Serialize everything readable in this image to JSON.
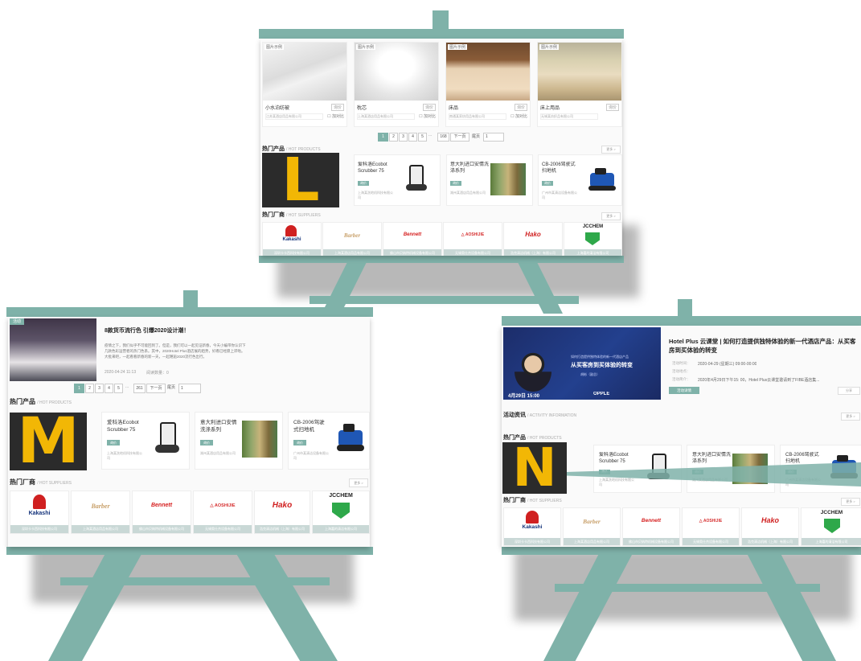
{
  "colors": {
    "teal": "#7fb2a9",
    "letter_fg": "#f2b705",
    "letter_bg": "#2b2b2b",
    "accent_blue": "#1a63c4",
    "pagination_active": "#7fb2a9"
  },
  "boards": {
    "L": {
      "letter": "L",
      "top_products": [
        {
          "title": "小水泊纺被",
          "tag": "询价",
          "supplier": "江苏某酒店用品有限公司",
          "badge": "图片示例"
        },
        {
          "title": "枕芯",
          "tag": "询价",
          "supplier": "上海某酒店用品有限公司",
          "badge": "图片示例"
        },
        {
          "title": "床品",
          "tag": "询价",
          "supplier": "南通某家纺用品有限公司",
          "badge": "图片示例"
        },
        {
          "title": "床上用品",
          "tag": "询价",
          "supplier": "无锡某纺织品有限公司",
          "badge": "图片示例"
        }
      ],
      "compare_label": "☐ 加对比",
      "pagination": {
        "pages": [
          "1",
          "2",
          "3",
          "4",
          "5",
          "...",
          "168"
        ],
        "next": "下一页",
        "last": "尾页",
        "select": "1"
      },
      "hot_products_title": "热门产品",
      "hot_products_sub": "/ HOT PRODUCTS",
      "more": "更多 >",
      "hot_products": [
        {
          "name": "爱科洛Ecobot Scrubber 75",
          "tag": "询价",
          "supplier": "上海某洗地机科技有限公司"
        },
        {
          "name": "意大利进口安情洗涤系列",
          "tag": "询价",
          "supplier": "湖州某酒店用品有限公司"
        },
        {
          "name": "CB-2006驾驶式扫地机",
          "tag": "询价",
          "supplier": "广州市某清洁设备有限公司"
        }
      ],
      "hot_suppliers_title": "热门厂商",
      "hot_suppliers_sub": "/ HOT SUPPLIERS"
    },
    "M": {
      "letter": "M",
      "article": {
        "badge": "活动",
        "title": "8款货币流行色 引爆2020设计潮！",
        "body": "疫情之下，我们似乎不可能回到了。但是，我们可以一起见证新春，今天小编带你认识下几款色彩运营者的热门色系。其中，2020Hotel Plus酒店展的趋势，好看已经愿上岸啦。大批来吧，一起看看新春的新一天，一起邂逅2020流行色出行。",
        "date": "2020-04-24 11:13",
        "reads": "阅读数量：0"
      },
      "pagination": {
        "pages": [
          "1",
          "2",
          "3",
          "4",
          "5",
          "...",
          "261"
        ],
        "next": "下一页",
        "last": "尾页",
        "select": "1"
      },
      "hot_products_title": "热门产品",
      "hot_products_sub": "/ HOT PRODUCTS",
      "hot_products": [
        {
          "name": "爱科洛Ecobot Scrubber 75",
          "tag": "询价",
          "supplier": "上海某洗地机科技有限公司"
        },
        {
          "name": "意大利进口安情洗涤系列",
          "tag": "询价",
          "supplier": "湖州某酒店用品有限公司"
        },
        {
          "name": "CB-2006驾驶式扫地机",
          "tag": "询价",
          "supplier": "广州市某清洁设备有限公司"
        }
      ],
      "hot_suppliers_title": "热门厂商",
      "hot_suppliers_sub": "/ HOT SUPPLIERS",
      "more": "更多 >"
    },
    "N": {
      "letter": "N",
      "event": {
        "title": "Hotel Plus 云课堂 | 如何打造提供独特体验的新一代酒店产品：从买客房到买体验的转变",
        "time_label": "活动时间：",
        "time": "2020-04-29 (星期三) 09:00-00:00",
        "place_label": "活动地点：",
        "intro_label": "活动简介：",
        "intro": "2020年4月29日下午15: 00，Hotel Plus云课堂邀请到了FIBE酒店集...",
        "btn": "活动详情",
        "share": "分享",
        "banner_heading": "从买客房到买体验的转变",
        "banner_sub": "如何打造提供独特体验的新一代酒店产品",
        "banner_date": "4月29日 15:00",
        "banner_brand": "OPPLE",
        "banner_person": "胡彬（副总）"
      },
      "activity_title": "活动资讯",
      "activity_sub": "/ ACTIVITY INFORMATION",
      "more": "更多 >",
      "hot_products_title": "热门产品",
      "hot_products_sub": "/ HOT PRODUCTS",
      "hot_products": [
        {
          "name": "爱科洛Ecobot Scrubber 75",
          "tag": "询价",
          "supplier": "上海某洗地机科技有限公司"
        },
        {
          "name": "意大利进口安情洗涤系列",
          "tag": "询价",
          "supplier": "湖州某酒店用品有限公司"
        },
        {
          "name": "CB-2006驾驶式扫地机",
          "tag": "询价",
          "supplier": "广州市某清洁设备有限公司"
        }
      ],
      "hot_suppliers_title": "热门厂商",
      "hot_suppliers_sub": "/ HOT SUPPLIERS"
    }
  },
  "suppliers": [
    {
      "logo": "Kakashi",
      "sub": "卡卡西科技",
      "caption": "深圳卡卡西科技有限公司"
    },
    {
      "logo": "Barber",
      "sub": "",
      "caption": "上海某酒店用品有限公司"
    },
    {
      "logo": "Bennett",
      "sub": "",
      "caption": "佛山市贝纳特机械设备有限公司"
    },
    {
      "logo": "△ AOSHIJIE",
      "sub": "",
      "caption": "无锡奥仕杰设备有限公司"
    },
    {
      "logo": "Hako",
      "sub": "",
      "caption": "浩克清洁机械（上海）有限公司"
    },
    {
      "logo": "JCCHEM",
      "sub": "",
      "caption": "上海嘉的清洁有限公司"
    }
  ]
}
